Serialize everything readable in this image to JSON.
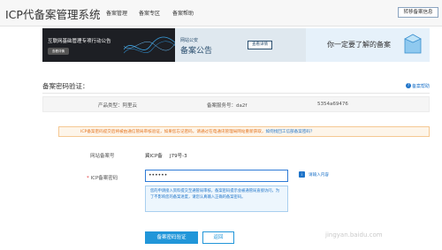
{
  "header": {
    "site_title": "ICP代备案管理系统",
    "nav": [
      "备案管理",
      "备案专区",
      "备案帮助"
    ],
    "top_button": "转移备案信息"
  },
  "banners": {
    "b1_text": "互联网基础管理专项行动公告",
    "b1_button": "查看详情",
    "b2_small": "网站公安",
    "b2_big": "备案公告",
    "b2_button": "查看详情",
    "b3_text": "你一定要了解的备案"
  },
  "section": {
    "title": "备案密码验证：",
    "help_link": "备案帮助",
    "help_icon": "?"
  },
  "info": {
    "product_type": "产品类型：阿里云",
    "service_no_label": "备案服务号：",
    "service_no_prefix": "da2f",
    "service_no_suffix": "5354a69476"
  },
  "warning": {
    "text": "ICP备案密码提交后将被由通信管局审核验证，如果您忘记密码，请通过在电通讯管理局网站重新获取，",
    "link": "如何找回工信部备案密码？"
  },
  "form": {
    "site_no_label": "网站备案号",
    "site_no_prefix": "冀ICP备",
    "site_no_value": "J79号-3",
    "password_label": "ICP备案密码",
    "password_value": "••••••",
    "tip_icon": "i",
    "tip_text": "请输入内容",
    "hint": "您的申请接入资料提交至通管局审核，备案密码提示会被通管局直接访问，为了不影响您的备案进度，请您认真输入正确的备案密码。"
  },
  "buttons": {
    "submit": "备案密码验证",
    "back": "返回"
  },
  "watermark": "jingyan.baidu.com"
}
